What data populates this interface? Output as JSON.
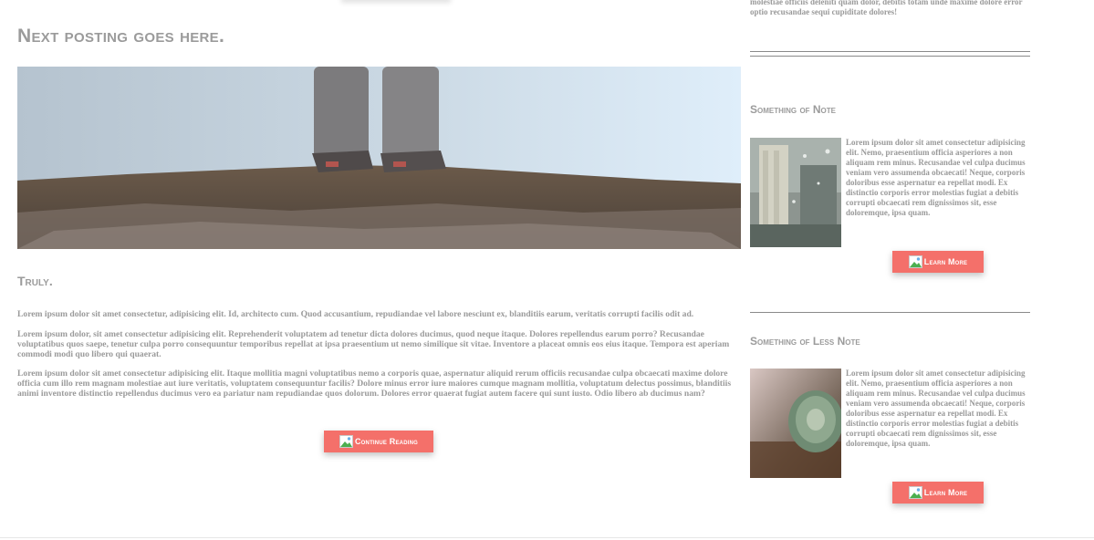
{
  "main": {
    "post_title": "Next posting goes here.",
    "subheading": "Truly.",
    "paragraphs": [
      "Lorem ipsum dolor sit amet consectetur, adipisicing elit. Id, architecto cum. Quod accusantium, repudiandae vel labore nesciunt ex, blanditiis earum, veritatis corrupti facilis odit ad.",
      "Lorem ipsum dolor, sit amet consectetur adipisicing elit. Reprehenderit voluptatem ad tenetur dicta dolores ducimus, quod neque itaque. Dolores repellendus earum porro? Recusandae voluptatibus quos saepe, tenetur culpa porro consequuntur temporibus repellat at ipsa praesentium ut nemo similique sit vitae. Inventore a placeat omnis eos eius itaque. Tempora est aperiam commodi modi quo libero qui quaerat.",
      "Lorem ipsum dolor sit amet consectetur adipisicing elit. Itaque mollitia magni voluptatibus nemo a corporis quae, aspernatur aliquid rerum officiis recusandae culpa obcaecati maxime dolore officia cum illo rem magnam molestiae aut iure veritatis, voluptatem consequuntur facilis? Dolore minus error iure maiores cumque magnam mollitia, voluptatum delectus possimus, blanditiis animi inventore distinctio repellendus ducimus vero ea pariatur nam repudiandae quos dolorum. Dolores error quaerat fugiat autem facere qui sunt iusto. Odio libero ab ducimus nam?"
    ],
    "continue_label": "Continue Reading"
  },
  "sidebar": {
    "top_text": "molestiae officiis deleniti quam dolor, debitis totam unde maxime dolore error optio recusandae sequi cupiditate dolores!",
    "sections": [
      {
        "heading": "Something of Note",
        "text": "Lorem ipsum dolor sit amet consectetur adipisicing elit. Nemo, praesentium officia asperiores a non aliquam rem minus. Recusandae vel culpa ducimus veniam vero assumenda obcaecati! Neque, corporis doloribus esse aspernatur ea repellat modi. Ex distinctio corporis error molestias fugiat a debitis corrupti obcaecati rem dignissimos sit, esse doloremque, ipsa quam.",
        "button_label": "Learn More"
      },
      {
        "heading": "Something of Less Note",
        "text": "Lorem ipsum dolor sit amet consectetur adipisicing elit. Nemo, praesentium officia asperiores a non aliquam rem minus. Recusandae vel culpa ducimus veniam vero assumenda obcaecati! Neque, corporis doloribus esse aspernatur ea repellat modi. Ex distinctio corporis error molestias fugiat a debitis corrupti obcaecati rem dignissimos sit, esse doloremque, ipsa quam.",
        "button_label": "Learn More"
      }
    ]
  },
  "icons": {
    "button_image": "broken-image-icon"
  },
  "colors": {
    "accent": "#f4706a",
    "text": "#9a9a9a",
    "rule": "#8a8a8a"
  }
}
